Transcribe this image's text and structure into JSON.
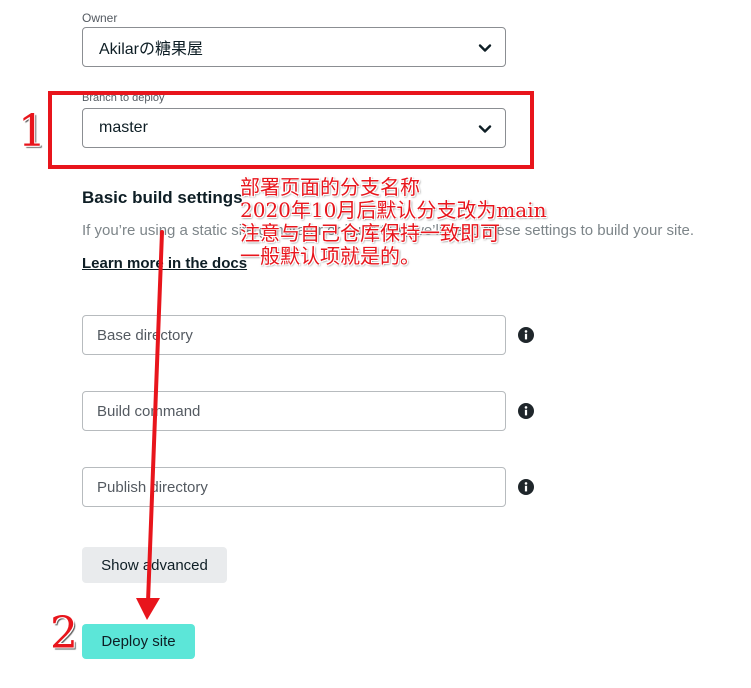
{
  "owner": {
    "label": "Owner",
    "value": "Akilarの糖果屋"
  },
  "branch": {
    "label": "Branch to deploy",
    "value": "master"
  },
  "build_settings": {
    "title": "Basic build settings",
    "description": "If you’re using a static site generator or build tool, we’ll need these settings to build your site.",
    "docs_link": "Learn more in the docs",
    "base_directory_placeholder": "Base directory",
    "build_command_placeholder": "Build command",
    "publish_directory_placeholder": "Publish directory"
  },
  "buttons": {
    "show_advanced": "Show advanced",
    "deploy": "Deploy site"
  },
  "annotation": {
    "marker_1": "1",
    "marker_2": "2",
    "lines": [
      "部署页面的分支名称",
      "2020年10月后默认分支改为main",
      "注意与自己仓库保持一致即可",
      "一般默认项就是的。"
    ]
  },
  "colors": {
    "annotation": "#e8151c",
    "deploy_button": "#5ce6d8",
    "advanced_button": "#e9ebed"
  },
  "icons": {
    "dropdown": "chevron-down-icon",
    "info": "info-icon"
  }
}
